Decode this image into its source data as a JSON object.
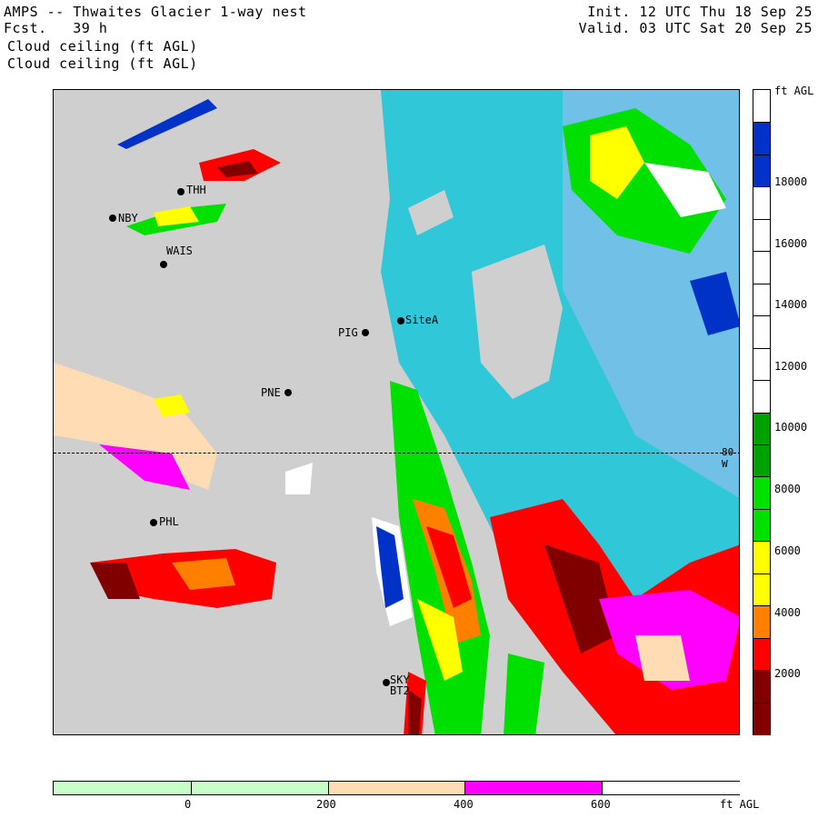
{
  "header": {
    "title": "AMPS -- Thwaites Glacier 1-way nest",
    "forecast": "Fcst.   39 h",
    "init": "Init. 12 UTC Thu 18 Sep 25",
    "valid": "Valid. 03 UTC Sat 20 Sep 25",
    "field_line1": "Cloud ceiling (ft AGL)",
    "field_line2": "Cloud ceiling (ft AGL)"
  },
  "map": {
    "stations": [
      "THH",
      "NBY",
      "WAIS",
      "PIG",
      "SiteA",
      "PNE",
      "PHL",
      "BT2",
      "SKY"
    ],
    "latitude_label": "80 W"
  },
  "colorbar": {
    "unit": "ft AGL",
    "ticks": [
      "18000",
      "16000",
      "14000",
      "12000",
      "10000",
      "8000",
      "6000",
      "4000",
      "2000"
    ],
    "colors": [
      "#ffffff",
      "#0032c8",
      "#0032c8",
      "#ffffff",
      "#ffffff",
      "#ffffff",
      "#ffffff",
      "#ffffff",
      "#ffffff",
      "#ffffff",
      "#00a000",
      "#00a000",
      "#00e000",
      "#00e000",
      "#ffff00",
      "#ffff00",
      "#ff8000",
      "#ff0000",
      "#800000",
      "#800000"
    ]
  },
  "lower_bar": {
    "unit": "ft AGL",
    "ticks": [
      "0",
      "200",
      "400",
      "600"
    ],
    "colors": [
      "#c8ffc8",
      "#c8ffc8",
      "#ffdcb4",
      "#ff00ff",
      "#ffffff"
    ]
  }
}
